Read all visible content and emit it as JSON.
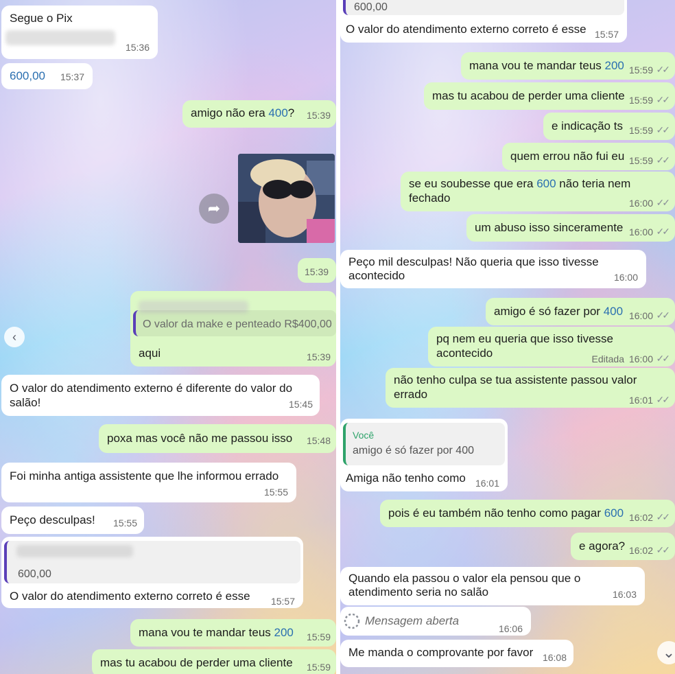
{
  "left": {
    "m1": {
      "text": "Segue o Pix",
      "time": "15:36"
    },
    "m2": {
      "text": "600,00",
      "time": "15:37"
    },
    "m3": {
      "text_a": "amigo não era ",
      "num": "400",
      "text_b": "?",
      "time": "15:39"
    },
    "m4": {
      "time": "15:39"
    },
    "m5": {
      "quote": "O valor da make e penteado R$400,00",
      "text": "aqui",
      "time": "15:39"
    },
    "m6": {
      "line1": "O valor do atendimento externo é diferente do valor do",
      "line2": "salão!",
      "time": "15:45"
    },
    "m7": {
      "text": "poxa mas você não me passou isso",
      "time": "15:48"
    },
    "m8": {
      "text": "Foi minha antiga assistente que lhe informou errado",
      "time": "15:55"
    },
    "m9": {
      "text": "Peço desculpas!",
      "time": "15:55"
    },
    "m10": {
      "quote": "600,00",
      "text": "O valor do atendimento externo correto é esse",
      "time": "15:57"
    },
    "m11": {
      "text_a": "mana vou te mandar teus ",
      "num": "200",
      "time": "15:59"
    },
    "m12": {
      "text": "mas tu acabou de perder uma cliente",
      "time": "15:59"
    }
  },
  "right": {
    "r1": {
      "quote": "600,00",
      "text": "O valor do atendimento externo correto é esse",
      "time": "15:57"
    },
    "r2": {
      "text_a": "mana vou te mandar teus ",
      "num": "200",
      "time": "15:59"
    },
    "r3": {
      "text": "mas tu acabou de perder uma cliente",
      "time": "15:59"
    },
    "r4": {
      "text": "e indicação ts",
      "time": "15:59"
    },
    "r5": {
      "text": "quem errou não fui eu",
      "time": "15:59"
    },
    "r6": {
      "text_a": "se eu soubesse que era ",
      "num": "600",
      "text_b": " não teria nem fechado",
      "time": "16:00"
    },
    "r7": {
      "text": "um abuso isso sinceramente",
      "time": "16:00"
    },
    "r8": {
      "line1": "Peço mil desculpas! Não queria que isso tivesse",
      "line2": "acontecido",
      "time": "16:00"
    },
    "r9": {
      "text_a": "amigo é só fazer por ",
      "num": "400",
      "time": "16:00"
    },
    "r10": {
      "text": "pq nem eu queria que isso tivesse acontecido",
      "edited": "Editada",
      "time": "16:00"
    },
    "r11": {
      "text": "não tenho culpa se tua assistente passou valor errado",
      "time": "16:01"
    },
    "r12": {
      "quote_author": "Você",
      "quote": "amigo é só fazer por 400",
      "text": "Amiga não tenho como",
      "time": "16:01"
    },
    "r13": {
      "text_a": "pois é eu também não tenho como pagar ",
      "num": "600",
      "time": "16:02"
    },
    "r14": {
      "text": "e agora?",
      "time": "16:02"
    },
    "r15": {
      "line1": "Quando ela passou o valor ela pensou que o",
      "line2": "atendimento seria no salão",
      "time": "16:03"
    },
    "r16": {
      "text": "Mensagem aberta",
      "time": "16:06"
    },
    "r17": {
      "text": "Me manda o comprovante por favor",
      "time": "16:08"
    }
  },
  "icons": {
    "read_ticks": "✓✓",
    "forward": "➦",
    "back_arrow": "‹",
    "scroll_down": "⌄"
  }
}
